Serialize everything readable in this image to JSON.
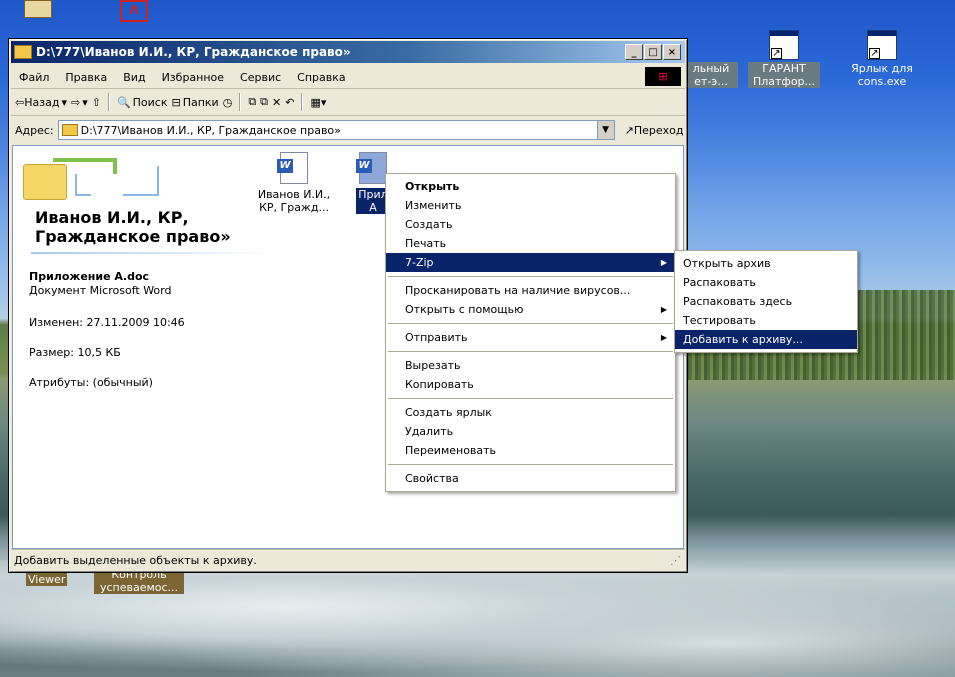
{
  "window": {
    "title": "D:\\777\\Иванов И.И., КР, Гражданское право»",
    "buttons": {
      "minimize": "_",
      "maximize": "□",
      "close": "×"
    }
  },
  "menubar": [
    "Файл",
    "Правка",
    "Вид",
    "Избранное",
    "Сервис",
    "Справка"
  ],
  "toolbar": {
    "back": "⇦Назад",
    "forward": "⇨",
    "up": "⇧",
    "search": "Поиск",
    "folders": "Папки",
    "view": "▦▾"
  },
  "address": {
    "label": "Адрес:",
    "value": "D:\\777\\Иванов И.И., КР, Гражданское право»",
    "go": "Переход"
  },
  "content": {
    "folder_title": "Иванов И.И., КР, Гражданское право»",
    "file_name": "Приложение А.doc",
    "file_type": "Документ Microsoft Word",
    "modified": "Изменен: 27.11.2009 10:46",
    "size": "Размер: 10,5 КБ",
    "attributes": "Атрибуты: (обычный)",
    "files": [
      {
        "label": "Иванов И.И., КР, Гражд..."
      },
      {
        "label": "Прил А"
      }
    ]
  },
  "status": "Добавить выделенные объекты к архиву.",
  "desktop_icons": [
    {
      "label": "льный ет-э..."
    },
    {
      "label": "ГАРАНТ Платфор..."
    },
    {
      "label": "Ярлык для cons.exe"
    },
    {
      "label": "Viewer"
    },
    {
      "label": "Контроль успеваемос..."
    }
  ],
  "context_menu": [
    {
      "label": "Открыть",
      "bold": true
    },
    {
      "label": "Изменить"
    },
    {
      "label": "Создать"
    },
    {
      "label": "Печать"
    },
    {
      "label": "7-Zip",
      "submenu": true,
      "highlighted": true
    },
    {
      "sep": true
    },
    {
      "label": "Просканировать на наличие вирусов..."
    },
    {
      "label": "Открыть с помощью",
      "submenu": true
    },
    {
      "sep": true
    },
    {
      "label": "Отправить",
      "submenu": true
    },
    {
      "sep": true
    },
    {
      "label": "Вырезать"
    },
    {
      "label": "Копировать"
    },
    {
      "sep": true
    },
    {
      "label": "Создать ярлык"
    },
    {
      "label": "Удалить"
    },
    {
      "label": "Переименовать"
    },
    {
      "sep": true
    },
    {
      "label": "Свойства"
    }
  ],
  "submenu_7zip": [
    {
      "label": "Открыть архив"
    },
    {
      "label": "Распаковать"
    },
    {
      "label": "Распаковать здесь"
    },
    {
      "label": "Тестировать"
    },
    {
      "label": "Добавить к архиву...",
      "highlighted": true
    }
  ]
}
